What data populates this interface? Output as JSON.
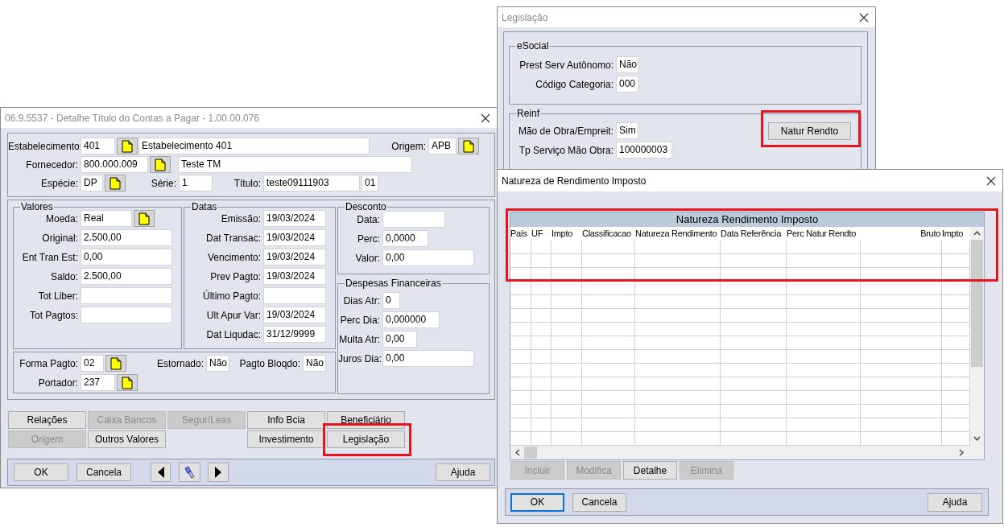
{
  "detail_window": {
    "title": "06.9.5537 - Detalhe Título do Contas a Pagar - 1.00.00.076",
    "active": false,
    "header_rows": [
      [
        {
          "label": "Estabelecimento:",
          "value": "401",
          "lookup": true
        },
        {
          "value": "Estabelecimento 401",
          "lookup": false
        },
        {
          "label": "Origem:",
          "value": "APB",
          "lookup": true
        }
      ],
      [
        {
          "label": "Fornecedor:",
          "value": "800.000.009",
          "lookup": true
        },
        {
          "value": "Teste TM",
          "lookup": false
        }
      ],
      [
        {
          "label": "Espécie:",
          "value": "DP",
          "lookup": true
        },
        {
          "label": "Série:",
          "value": "1",
          "lookup": false
        },
        {
          "label": "Título:",
          "value": "teste09111903",
          "lookup": false
        },
        {
          "value": "01",
          "lookup": false
        }
      ]
    ],
    "valores": {
      "title": "Valores",
      "fields": [
        {
          "label": "Moeda:",
          "value": "Real",
          "lookup": true
        },
        {
          "label": "Original:",
          "value": "2.500,00",
          "lookup": false
        },
        {
          "label": "Ent Tran Est:",
          "value": "0,00",
          "lookup": false
        },
        {
          "label": "Saldo:",
          "value": "2.500,00",
          "lookup": false
        },
        {
          "label": "Tot Liber:",
          "lookup": false
        },
        {
          "label": "Tot Pagtos:",
          "lookup": false
        }
      ]
    },
    "datas": {
      "title": "Datas",
      "fields": [
        {
          "label": "Emissão:",
          "value": "19/03/2024"
        },
        {
          "label": "Dat Transac:",
          "value": "19/03/2024"
        },
        {
          "label": "Vencimento:",
          "value": "19/03/2024"
        },
        {
          "label": "Prev Pagto:",
          "value": "19/03/2024"
        },
        {
          "label": "Último Pagto:"
        },
        {
          "label": "Ult Apur Var:",
          "value": "19/03/2024"
        },
        {
          "label": "Dat Liqudac:",
          "value": "31/12/9999"
        }
      ]
    },
    "desconto": {
      "title": "Desconto",
      "fields": [
        {
          "label": "Data:"
        },
        {
          "label": "Perc:",
          "value": "0,0000"
        },
        {
          "label": "Valor:",
          "value": "0,00"
        }
      ]
    },
    "despesas": {
      "title": "Despesas Financeiras",
      "fields": [
        {
          "label": "Dias Atr:",
          "value": "0"
        },
        {
          "label": "Perc Dia:",
          "value": "0,000000"
        },
        {
          "label": "Multa Atr:",
          "value": "0,00"
        },
        {
          "label": "Juros Dia:",
          "value": "0,00"
        }
      ]
    },
    "pagamento": [
      [
        {
          "label": "Forma Pagto:",
          "value": "02",
          "lookup": true
        },
        {
          "label": "Estornado:",
          "value": "Não",
          "lookup": false
        },
        {
          "label": "Pagto Bloqdo:",
          "value": "Não",
          "lookup": false
        }
      ],
      [
        {
          "label": "Portador:",
          "value": "237",
          "lookup": true
        }
      ]
    ],
    "buttons": [
      {
        "label": "Relações",
        "disabled": false,
        "highlighted": false
      },
      {
        "label": "Caixa Bancos",
        "disabled": true,
        "highlighted": false
      },
      {
        "label": "Segur/Leas",
        "disabled": true,
        "highlighted": false
      },
      {
        "label": "Info Bcia",
        "disabled": false,
        "highlighted": false
      },
      {
        "label": "Beneficiário",
        "disabled": false,
        "highlighted": false
      },
      {
        "label": "Origem",
        "disabled": true,
        "highlighted": false
      },
      {
        "label": "Outros Valores",
        "disabled": false,
        "highlighted": false
      },
      {
        "label": "Investimento",
        "disabled": false,
        "highlighted": false
      },
      {
        "label": "Legislação",
        "disabled": false,
        "highlighted": true
      }
    ],
    "footer": {
      "ok": "OK",
      "cancel": "Cancela",
      "help": "Ajuda"
    }
  },
  "legislacao_window": {
    "title": "Legislação",
    "active": false,
    "esocial": {
      "title": "eSocial",
      "fields": [
        {
          "label": "Prest Serv Autônomo:",
          "value": "Não"
        },
        {
          "label": "Código Categoria:",
          "value": "000"
        }
      ]
    },
    "reinf": {
      "title": "Reinf",
      "fields": [
        {
          "label": "Mão de Obra/Empreit:",
          "value": "Sim"
        },
        {
          "label": "Tp Serviço Mão Obra:",
          "value": "100000003"
        }
      ],
      "button": {
        "label": "Natur Rendto",
        "highlighted": true
      }
    }
  },
  "natureza_window": {
    "title": "Natureza de Rendimento Imposto",
    "active": true,
    "grid": {
      "title": "Natureza Rendimento Imposto",
      "highlighted": true,
      "columns": [
        "País",
        "UF",
        "Impto",
        "Classificacao",
        "Natureza Rendimento",
        "Data Referência",
        "Perc Natur Rendto",
        "Bruto",
        "Impto"
      ]
    },
    "buttons": [
      {
        "label": "Incluir",
        "disabled": true
      },
      {
        "label": "Modifica",
        "disabled": true
      },
      {
        "label": "Detalhe",
        "disabled": false
      },
      {
        "label": "Elimina",
        "disabled": true
      }
    ],
    "footer": {
      "ok": "OK",
      "ok_focused": true,
      "cancel": "Cancela",
      "help": "Ajuda"
    }
  }
}
